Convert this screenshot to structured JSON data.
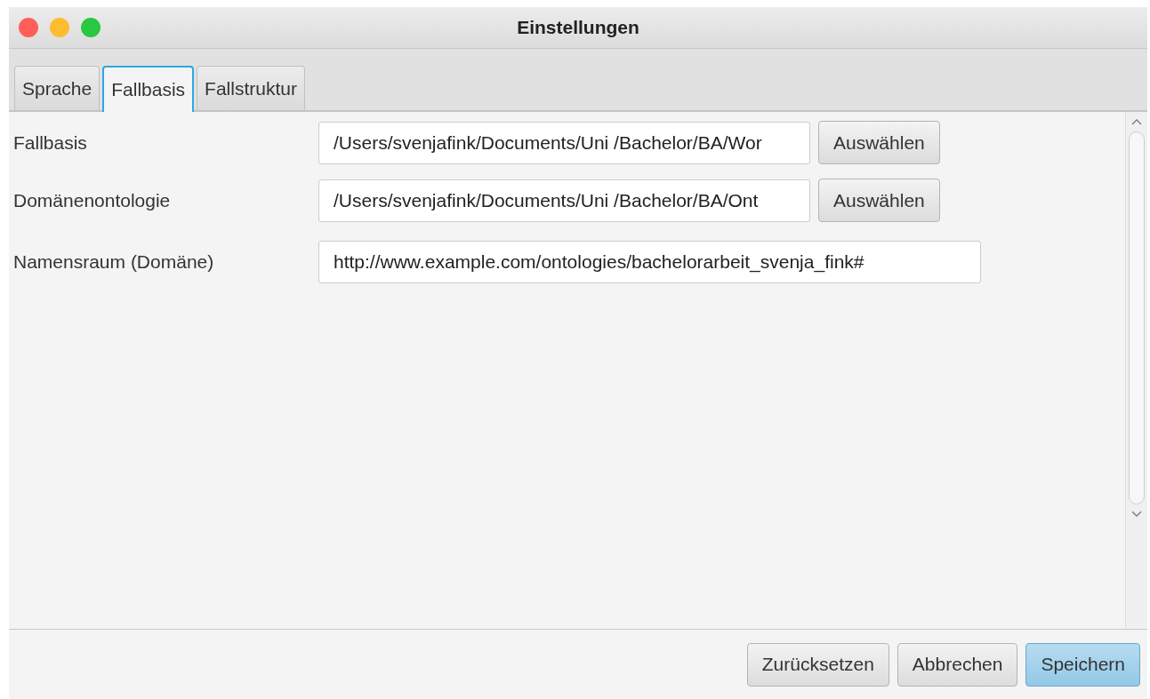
{
  "window": {
    "title": "Einstellungen"
  },
  "tabs": [
    {
      "label": "Sprache",
      "selected": false
    },
    {
      "label": "Fallbasis",
      "selected": true
    },
    {
      "label": "Fallstruktur",
      "selected": false
    }
  ],
  "settings": [
    {
      "label": "Fallbasis",
      "value": "/Users/svenjafink/Documents/Uni /Bachelor/BA/Wor",
      "button": "Auswählen"
    },
    {
      "label": "Domänenontologie",
      "value": "/Users/svenjafink/Documents/Uni /Bachelor/BA/Ont",
      "button": "Auswählen"
    },
    {
      "label": "Namensraum (Domäne)",
      "value": "http://www.example.com/ontologies/bachelorarbeit_svenja_fink#"
    }
  ],
  "buttons": [
    {
      "label": "Zurücksetzen",
      "default": false
    },
    {
      "label": "Abbrechen",
      "default": false
    },
    {
      "label": "Speichern",
      "default": true
    }
  ]
}
